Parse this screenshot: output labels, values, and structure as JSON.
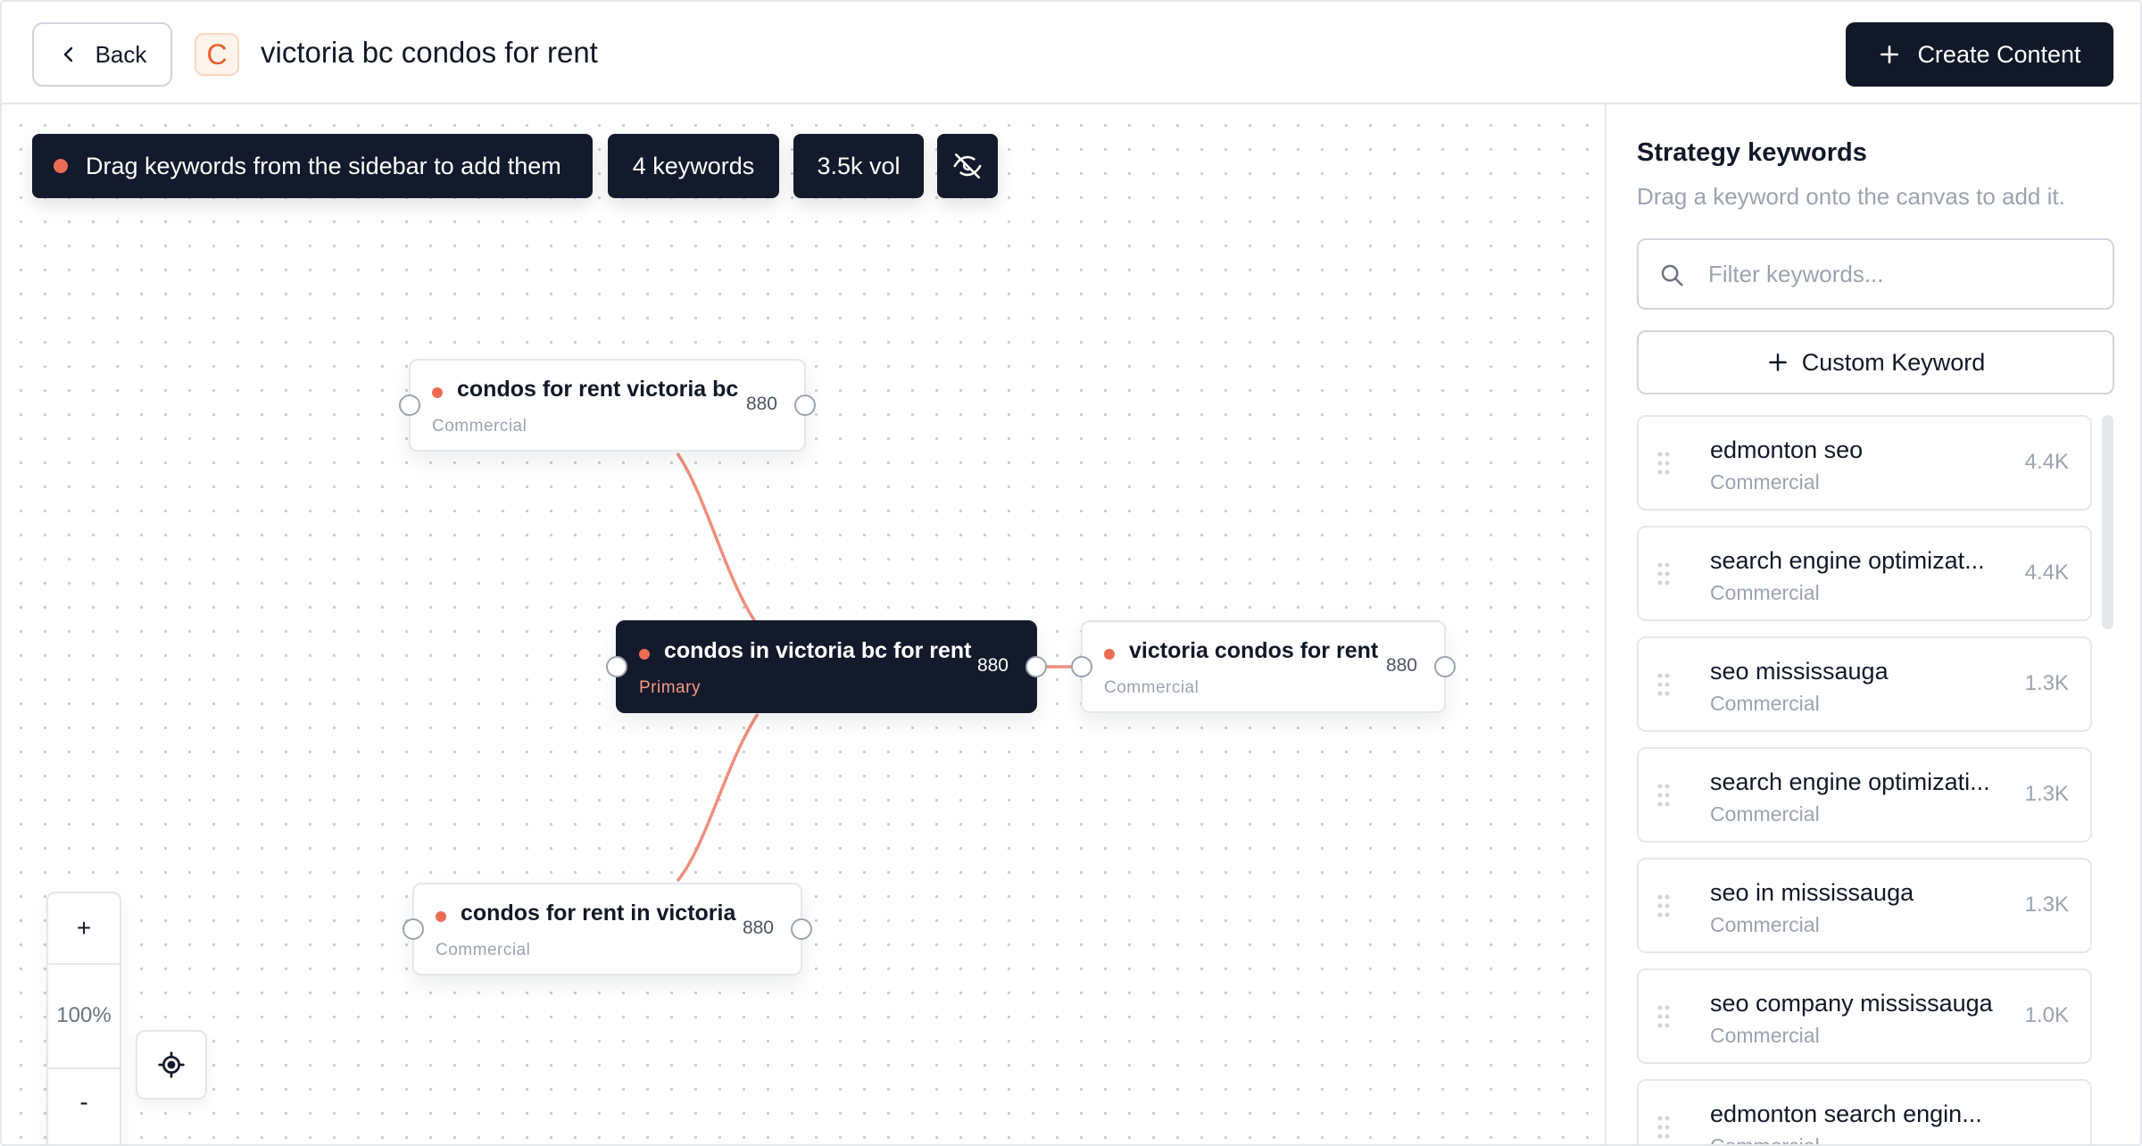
{
  "header": {
    "back_label": "Back",
    "badge_letter": "C",
    "title": "victoria bc condos for rent",
    "create_label": "Create Content"
  },
  "canvas": {
    "hint": "Drag keywords from the sidebar to add them",
    "keyword_count": "4 keywords",
    "volume": "3.5k vol",
    "zoom_in": "+",
    "zoom_level": "100%",
    "zoom_out": "-",
    "nodes": [
      {
        "title": "condos for rent victoria bc",
        "tag": "Commercial",
        "volume": "880"
      },
      {
        "title": "condos in victoria bc for rent",
        "tag": "Primary",
        "volume": "880"
      },
      {
        "title": "victoria condos for rent",
        "tag": "Commercial",
        "volume": "880"
      },
      {
        "title": "condos for rent in victoria",
        "tag": "Commercial",
        "volume": "880"
      }
    ]
  },
  "sidebar": {
    "title": "Strategy keywords",
    "subtitle": "Drag a keyword onto the canvas to add it.",
    "filter_placeholder": "Filter keywords...",
    "custom_label": "Custom Keyword",
    "keywords": [
      {
        "name": "edmonton seo",
        "tag": "Commercial",
        "volume": "4.4K"
      },
      {
        "name": "search engine optimizat...",
        "tag": "Commercial",
        "volume": "4.4K"
      },
      {
        "name": "seo mississauga",
        "tag": "Commercial",
        "volume": "1.3K"
      },
      {
        "name": "search engine optimizati...",
        "tag": "Commercial",
        "volume": "1.3K"
      },
      {
        "name": "seo in mississauga",
        "tag": "Commercial",
        "volume": "1.3K"
      },
      {
        "name": "seo company mississauga",
        "tag": "Commercial",
        "volume": "1.0K"
      },
      {
        "name": "edmonton search engin...",
        "tag": "Commercial",
        "volume": ""
      }
    ]
  },
  "colors": {
    "accent": "#ec6b54",
    "dark": "#131a2b",
    "edge": "#ee8f7c"
  }
}
